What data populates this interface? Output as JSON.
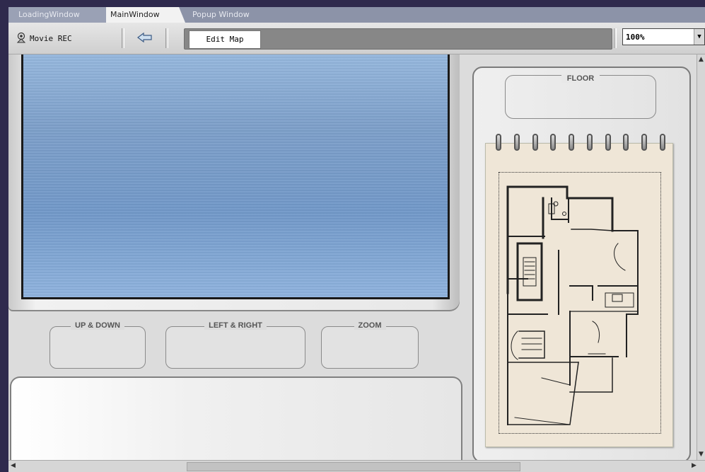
{
  "tabs": [
    {
      "label": "LoadingWindow",
      "active": false
    },
    {
      "label": "MainWindow",
      "active": true
    },
    {
      "label": "Popup Window",
      "active": false
    }
  ],
  "toolbar": {
    "movie_rec_label": "Movie REC",
    "movie_icon": "webcam-icon",
    "back_icon": "back-arrow-icon",
    "edit_map_label": "Edit Map",
    "zoom_value": "100%"
  },
  "controls": {
    "up_down_label": "UP & DOWN",
    "left_right_label": "LEFT & RIGHT",
    "zoom_label": "ZOOM"
  },
  "floor": {
    "label": "FLOOR"
  },
  "colors": {
    "frame": "#2f2a4d",
    "video_top": "#95b7dd",
    "video_bottom": "#7198c8",
    "notepad": "#efe6d7"
  }
}
